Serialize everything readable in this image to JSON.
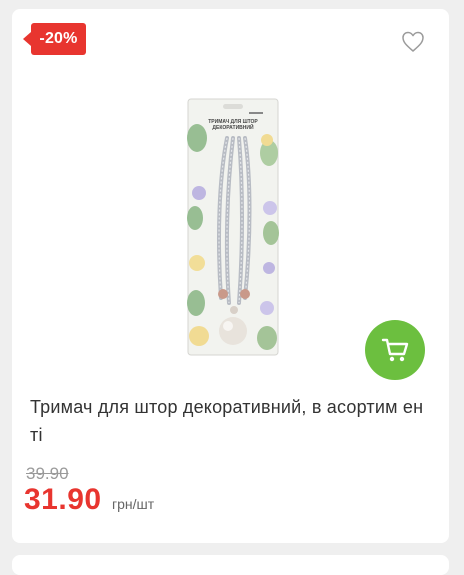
{
  "product": {
    "discount_badge": "-20%",
    "title": "Тримач для штор декоративний, в асортим енті",
    "old_price": "39.90",
    "price": "31.90",
    "unit": "грн/шт",
    "package_text": "ТРИМАЧ ДЛЯ ШТОР ДЕКОРАТИВНИЙ",
    "favorite_icon": "heart-outline-icon",
    "cart_icon": "shopping-cart-icon"
  },
  "colors": {
    "discount": "#e8352f",
    "price": "#e8352f",
    "cart_button": "#6cbf3f"
  }
}
